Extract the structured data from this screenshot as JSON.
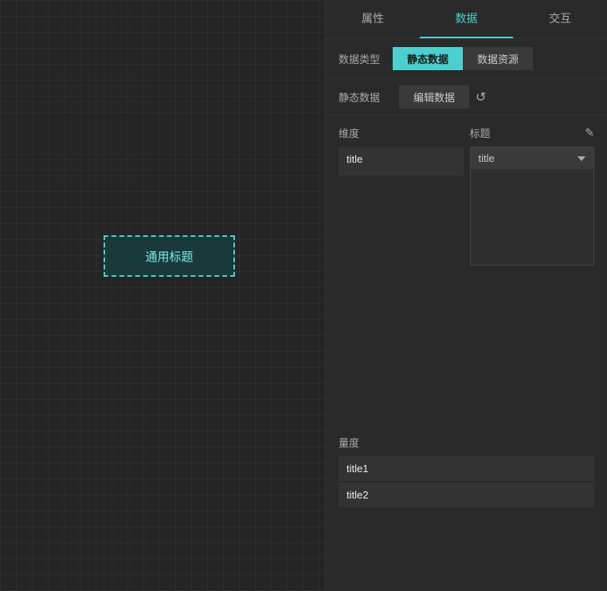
{
  "canvas": {
    "widget_label": "通用标题"
  },
  "panel": {
    "tabs": [
      {
        "id": "properties",
        "label": "属性",
        "active": false
      },
      {
        "id": "data",
        "label": "数据",
        "active": true
      },
      {
        "id": "interaction",
        "label": "交互",
        "active": false
      }
    ],
    "data_type_label": "数据类型",
    "data_type_buttons": [
      {
        "id": "static",
        "label": "静态数据",
        "active": true
      },
      {
        "id": "resource",
        "label": "数据资源",
        "active": false
      }
    ],
    "static_data_label": "静态数据",
    "edit_data_label": "编辑数据",
    "dimension_label": "维度",
    "title_label": "标题",
    "edit_icon": "✎",
    "reset_icon": "↺",
    "dimension_value": "title",
    "title_dropdown_value": "title",
    "measure_label": "量度",
    "measure_items": [
      {
        "id": "title1",
        "label": "title1"
      },
      {
        "id": "title2",
        "label": "title2"
      }
    ]
  }
}
